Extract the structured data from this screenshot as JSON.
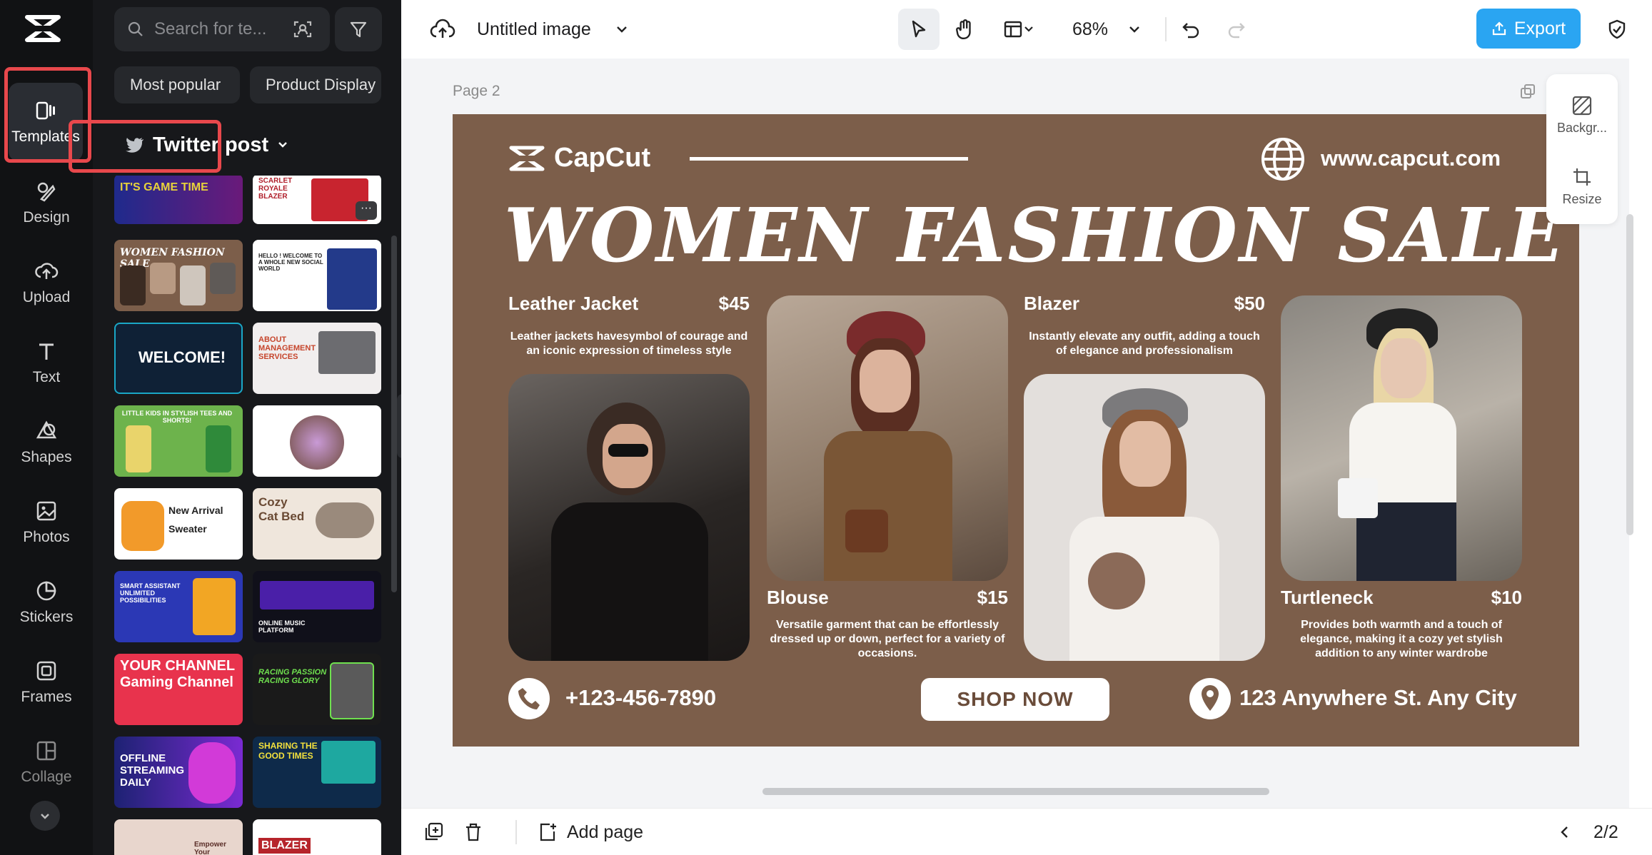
{
  "rail": {
    "items": [
      {
        "label": "Templates",
        "icon": "templates-icon"
      },
      {
        "label": "Design",
        "icon": "design-icon"
      },
      {
        "label": "Upload",
        "icon": "upload-icon"
      },
      {
        "label": "Text",
        "icon": "text-icon"
      },
      {
        "label": "Shapes",
        "icon": "shapes-icon"
      },
      {
        "label": "Photos",
        "icon": "photos-icon"
      },
      {
        "label": "Stickers",
        "icon": "stickers-icon"
      },
      {
        "label": "Frames",
        "icon": "frames-icon"
      },
      {
        "label": "Collage",
        "icon": "collage-icon"
      }
    ]
  },
  "panel": {
    "search_placeholder": "Search for te...",
    "chips": [
      "Most popular",
      "Product Display"
    ],
    "category": "Twitter post",
    "thumbnails": [
      {
        "text": "IT'S GAME TIME"
      },
      {
        "text": "SCARLET ROYALE BLAZER"
      },
      {
        "text": "WOMEN FASHION SALE"
      },
      {
        "text": "HELLO ! WELCOME TO A WHOLE NEW SOCIAL WORLD"
      },
      {
        "text": "WELCOME!"
      },
      {
        "text": "ABOUT MANAGEMENT SERVICES"
      },
      {
        "text": "LITTLE KIDS IN STYLISH TEES AND SHORTS!"
      },
      {
        "text": ""
      },
      {
        "text": "New Arrival Sweater"
      },
      {
        "text": "Cozy Cat Bed"
      },
      {
        "text": "SMART ASSISTANT UNLIMITED POSSIBILITIES"
      },
      {
        "text": "ONLINE MUSIC PLATFORM"
      },
      {
        "text": "YOUR CHANNEL Gaming Channel"
      },
      {
        "text": "RACING PASSION RACING GLORY"
      },
      {
        "text": "OFFLINE STREAMING DAILY"
      },
      {
        "text": "SHARING THE GOOD TIMES"
      },
      {
        "text": "Empower Your"
      },
      {
        "text": "BLAZER"
      }
    ]
  },
  "topbar": {
    "title": "Untitled image",
    "zoom": "68%",
    "export_label": "Export"
  },
  "canvas": {
    "page_label": "Page 2",
    "right_tools": [
      "Backgr...",
      "Resize"
    ]
  },
  "poster": {
    "brand": "CapCut",
    "url": "www.capcut.com",
    "headline": "WOMEN FASHION SALE",
    "items": [
      {
        "name": "Leather Jacket",
        "price": "$45",
        "desc": "Leather jackets havesymbol of courage and an iconic expression of timeless style"
      },
      {
        "name": "Blouse",
        "price": "$15",
        "desc": "Versatile garment that can be effortlessly dressed up or down, perfect for a variety of occasions."
      },
      {
        "name": "Blazer",
        "price": "$50",
        "desc": "Instantly elevate any outfit, adding a touch of elegance and professionalism"
      },
      {
        "name": "Turtleneck",
        "price": "$10",
        "desc": "Provides both warmth and a touch of elegance, making it a cozy yet stylish addition to any winter wardrobe"
      }
    ],
    "phone": "+123-456-7890",
    "shop_now": "SHOP NOW",
    "address": "123 Anywhere St. Any City"
  },
  "bottombar": {
    "add_page": "Add page",
    "page_count": "2/2"
  },
  "colors": {
    "poster_bg": "#7c5e4a",
    "accent": "#2aa5f2",
    "highlight": "#e8484c"
  }
}
